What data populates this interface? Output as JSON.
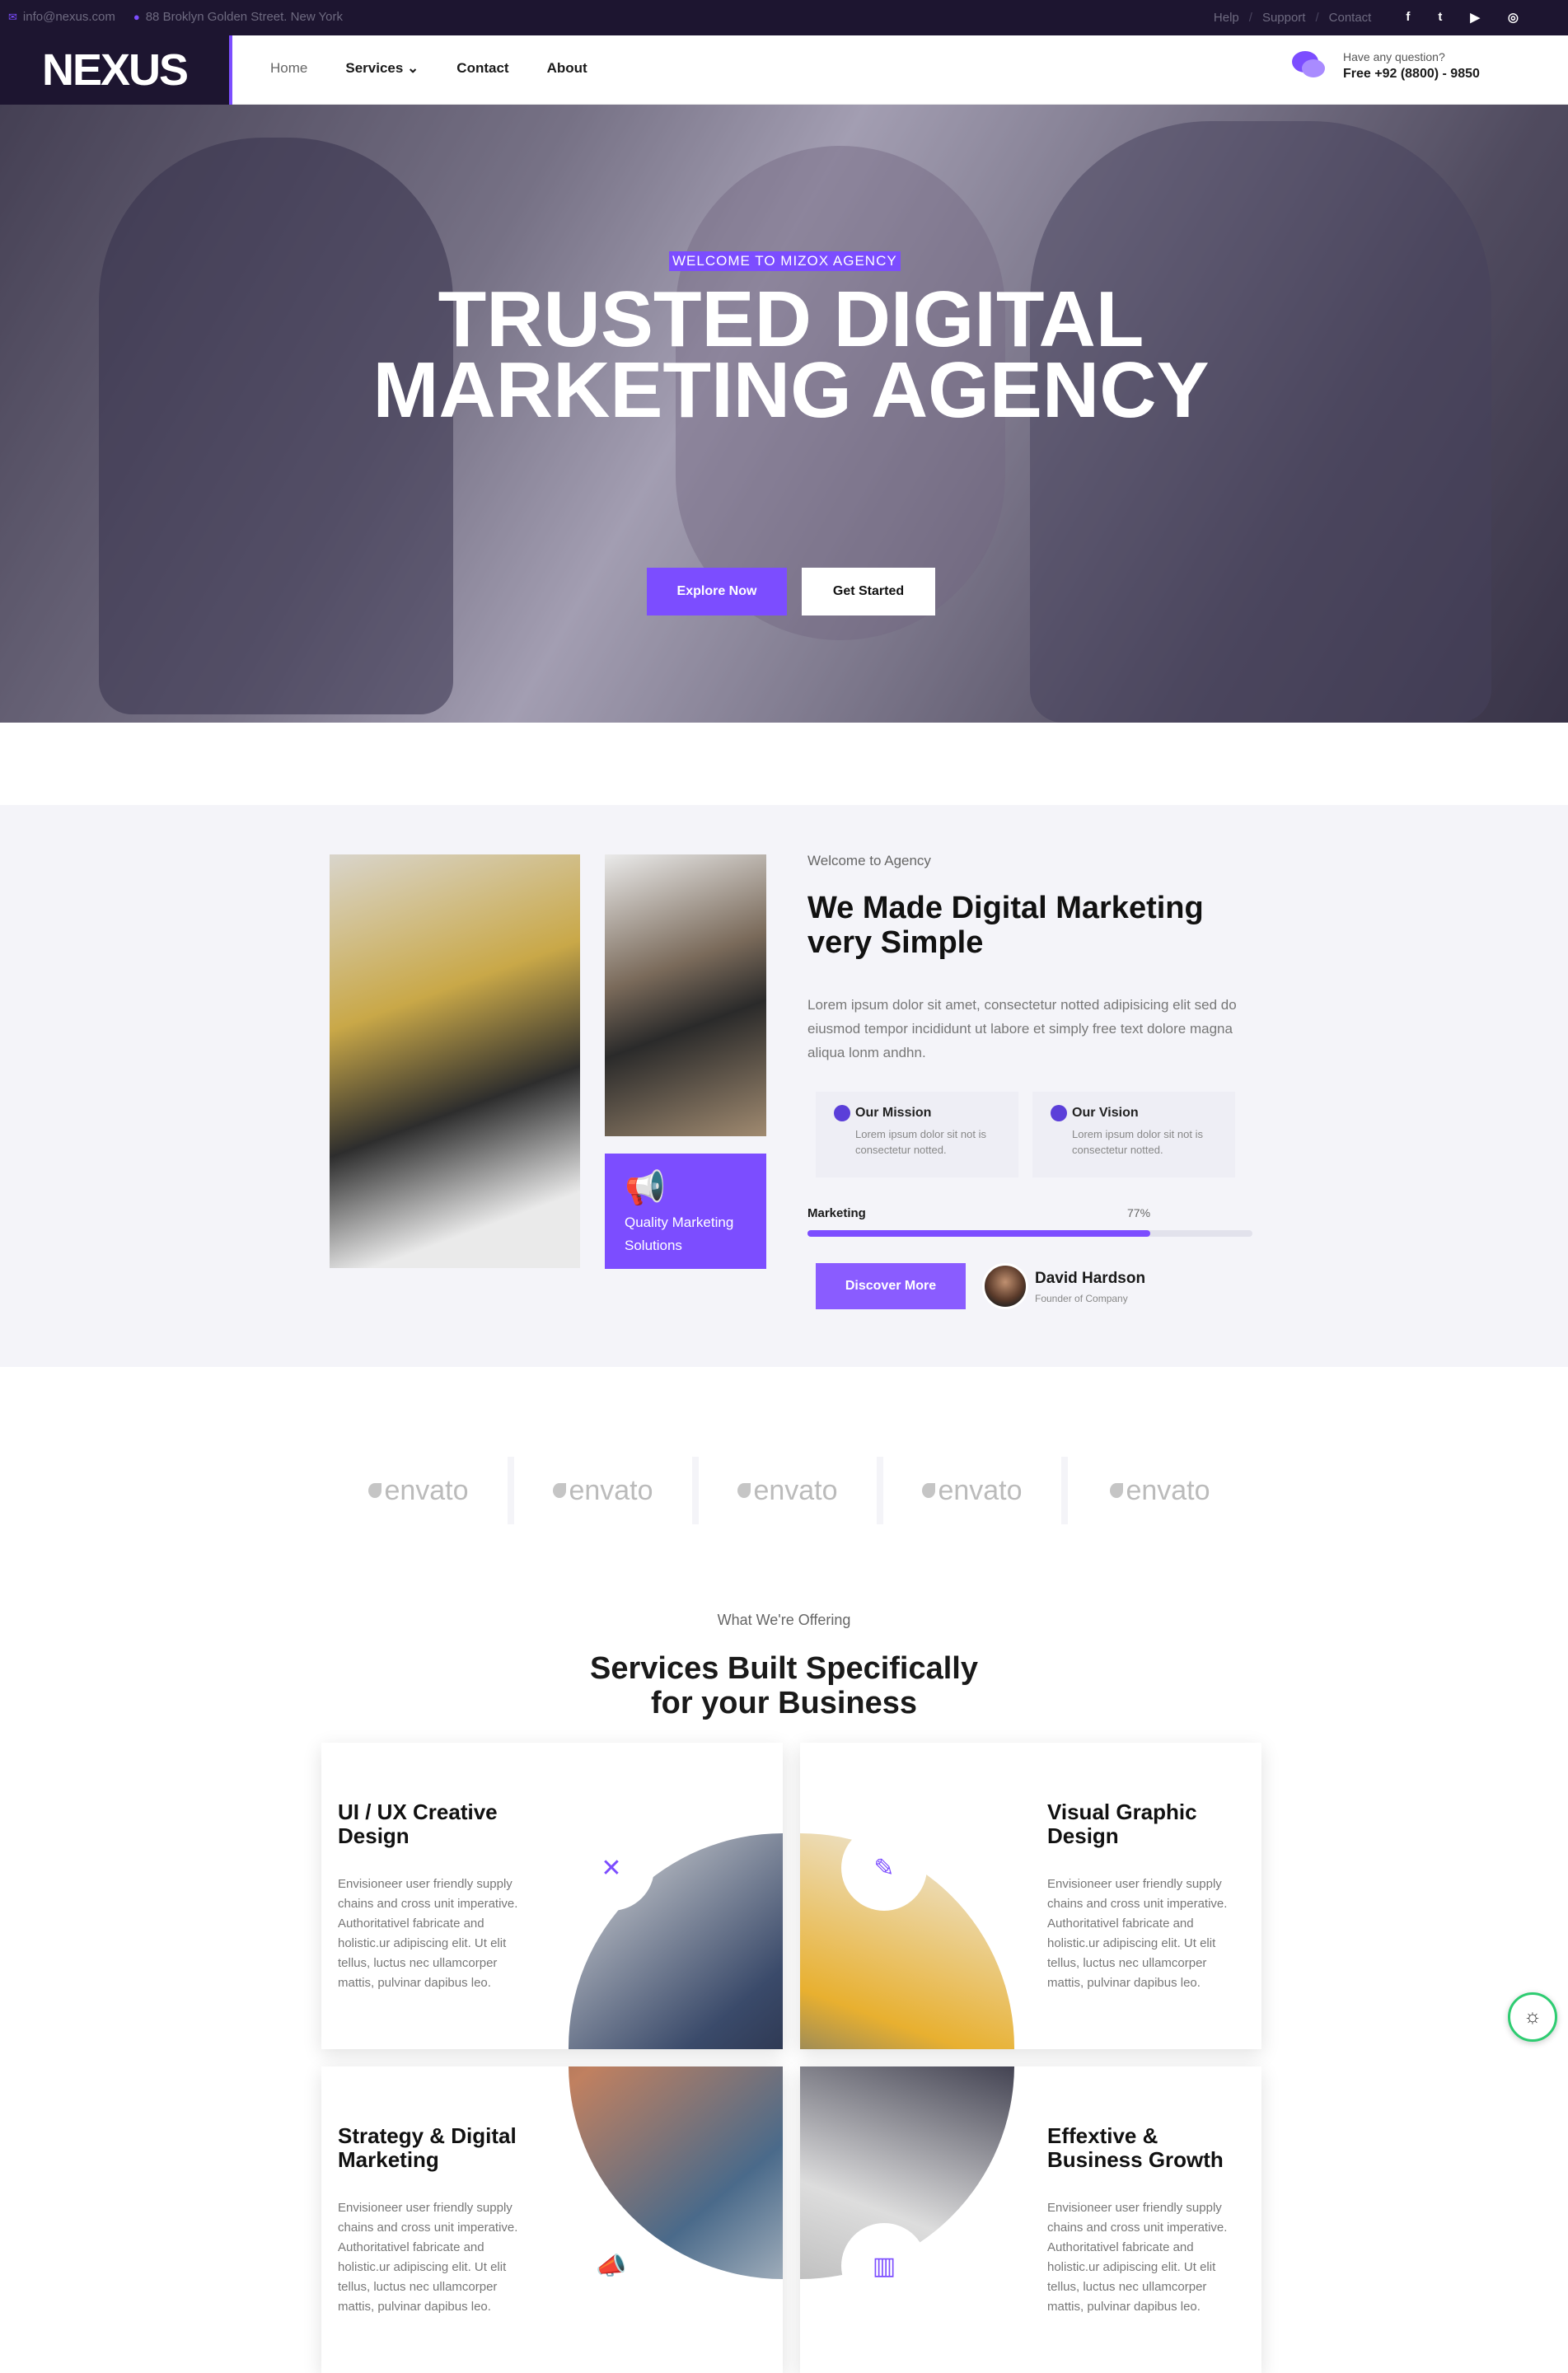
{
  "topbar": {
    "email": "info@nexus.com",
    "address": "88 Broklyn Golden Street. New York",
    "links": [
      "Help",
      "Support",
      "Contact"
    ],
    "social": [
      "facebook-icon",
      "twitter-icon",
      "youtube-icon",
      "instagram-icon"
    ]
  },
  "header": {
    "logo": "NEXUS",
    "nav": [
      "Home",
      "Services",
      "Contact",
      "About"
    ],
    "question": "Have any question?",
    "phone": "Free +92 (8800) - 9850"
  },
  "hero": {
    "kicker": "WELCOME TO MIZOX AGENCY",
    "title": "TRUSTED DIGITAL MARKETING AGENCY",
    "btn_primary": "Explore Now",
    "btn_secondary": "Get Started"
  },
  "about": {
    "kicker": "Welcome to Agency",
    "title": "We Made Digital Marketing very Simple",
    "paragraph": "Lorem ipsum dolor sit amet, consectetur notted adipisicing elit sed do eiusmod tempor incididunt ut labore et simply free text dolore magna aliqua lonm andhn.",
    "quality": "Quality Marketing Solutions",
    "mission_title": "Our Mission",
    "mission_text": "Lorem ipsum dolor sit not is consectetur notted.",
    "vision_title": "Our Vision",
    "vision_text": "Lorem ipsum dolor sit not is consectetur notted.",
    "progress_label": "Marketing",
    "progress_text": "77%",
    "progress_value": 0.77,
    "discover": "Discover More",
    "person_name": "David Hardson",
    "person_role": "Founder of Company"
  },
  "brands": [
    "envato",
    "envato",
    "envato",
    "envato",
    "envato"
  ],
  "services": {
    "kicker": "What We're Offering",
    "title": "Services Built Specifically for your Business",
    "cards": [
      {
        "title": "UI / UX Creative Design",
        "text": "Envisioneer user friendly supply chains and cross unit imperative. Authoritativel fabricate and holistic.ur adipiscing elit. Ut elit tellus, luctus nec ullamcorper mattis, pulvinar dapibus leo.",
        "icon": "pencil-ruler-icon"
      },
      {
        "title": "Visual Graphic Design",
        "text": "Envisioneer user friendly supply chains and cross unit imperative. Authoritativel fabricate and holistic.ur adipiscing elit. Ut elit tellus, luctus nec ullamcorper mattis, pulvinar dapibus leo.",
        "icon": "pen-tool-icon"
      },
      {
        "title": "Strategy & Digital Marketing",
        "text": "Envisioneer user friendly supply chains and cross unit imperative. Authoritativel fabricate and holistic.ur adipiscing elit. Ut elit tellus, luctus nec ullamcorper mattis, pulvinar dapibus leo.",
        "icon": "megaphone-icon"
      },
      {
        "title": "Effextive & Business Growth",
        "text": "Envisioneer user friendly supply chains and cross unit imperative. Authoritativel fabricate and holistic.ur adipiscing elit. Ut elit tellus, luctus nec ullamcorper mattis, pulvinar dapibus leo.",
        "icon": "growth-chart-icon"
      }
    ]
  },
  "colors": {
    "accent": "#7c4dff",
    "dark": "#1d1530"
  }
}
